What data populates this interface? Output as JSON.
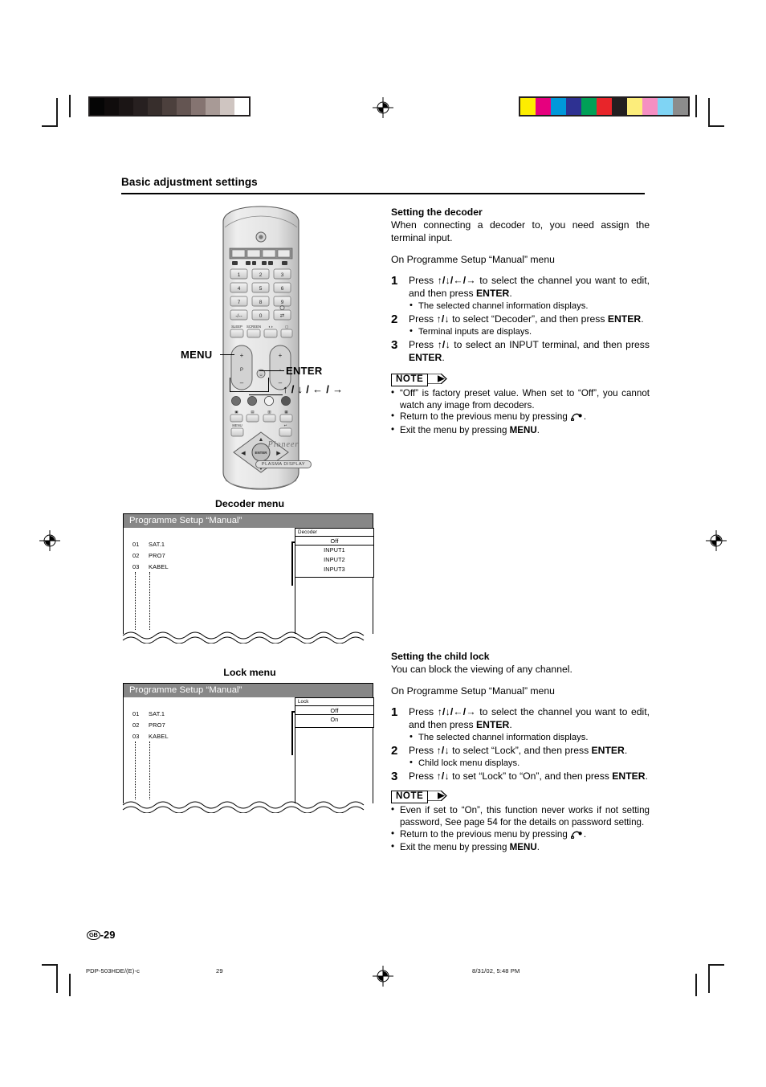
{
  "page": {
    "section_title": "Basic adjustment settings",
    "page_number": "-29",
    "page_locale_badge": "GB"
  },
  "footer": {
    "doc_id": "PDP-503HDE/(E)-c",
    "folio": "29",
    "timestamp": "8/31/02, 5:48 PM"
  },
  "remote": {
    "brand": "Pioneer",
    "model_badge": "PLASMA DISPLAY",
    "callouts": {
      "menu": "MENU",
      "enter": "ENTER",
      "dpad": "↑ / ↓ / ← / →"
    },
    "enter_button_label": "ENTER",
    "menu_button_label": "MENU"
  },
  "decoder_section": {
    "heading": "Setting the decoder",
    "intro": "When connecting a decoder to, you need assign the terminal input.",
    "context": "On Programme Setup “Manual” menu",
    "steps": [
      {
        "num": "1",
        "text_1": "Press ",
        "arrows": "↑/↓/←/→",
        "text_2": " to select the channel you want to edit, and then press ",
        "bold": "ENTER",
        "text_3": ".",
        "sub": "The selected channel information displays."
      },
      {
        "num": "2",
        "text_1": "Press ",
        "arrows": "↑/↓",
        "text_2": " to select “Decoder”, and then press ",
        "bold": "ENTER",
        "text_3": ".",
        "sub": "Terminal inputs are displays."
      },
      {
        "num": "3",
        "text_1": "Press ",
        "arrows": "↑/↓",
        "text_2": " to select an INPUT terminal, and then press ",
        "bold": "ENTER",
        "text_3": ".",
        "sub": ""
      }
    ],
    "note_label": "NOTE",
    "notes": [
      "“Off” is factory preset value. When set to “Off”, you cannot watch any image from decoders.",
      "Return to the previous menu by pressing",
      "Exit the menu by pressing"
    ],
    "note_3_bold": "MENU"
  },
  "lock_section": {
    "heading": "Setting the child lock",
    "intro": "You can block the viewing of any channel.",
    "context": "On Programme Setup “Manual” menu",
    "steps": [
      {
        "num": "1",
        "text_1": "Press ",
        "arrows": "↑/↓/←/→",
        "text_2": " to select the channel you want to edit, and then press ",
        "bold": "ENTER",
        "text_3": ".",
        "sub": "The selected channel information displays."
      },
      {
        "num": "2",
        "text_1": "Press ",
        "arrows": "↑/↓",
        "text_2": " to select “Lock”, and then press ",
        "bold": "ENTER",
        "text_3": ".",
        "sub": "Child lock menu displays."
      },
      {
        "num": "3",
        "text_1": "Press ",
        "arrows": "↑/↓",
        "text_2": " to set “Lock” to “On”, and then press ",
        "bold": "ENTER",
        "text_3": ".",
        "sub": ""
      }
    ],
    "note_label": "NOTE",
    "notes": [
      "Even if set to “On”, this function never works if not setting password, See page 54 for the details on password setting.",
      "Return to the previous menu by pressing",
      "Exit the menu by pressing"
    ],
    "note_3_bold": "MENU"
  },
  "decoder_menu_figure": {
    "caption": "Decoder menu",
    "osd_title": "Programme Setup “Manual”",
    "channels": [
      {
        "no": "01",
        "name": "SAT.1"
      },
      {
        "no": "02",
        "name": "PRO7"
      },
      {
        "no": "03",
        "name": "KABEL"
      }
    ],
    "submenu_label": "Decoder",
    "options": [
      "Off",
      "INPUT1",
      "INPUT2",
      "INPUT3"
    ],
    "selected_option": "Off"
  },
  "lock_menu_figure": {
    "caption": "Lock menu",
    "osd_title": "Programme Setup “Manual”",
    "channels": [
      {
        "no": "01",
        "name": "SAT.1"
      },
      {
        "no": "02",
        "name": "PRO7"
      },
      {
        "no": "03",
        "name": "KABEL"
      }
    ],
    "submenu_label": "Lock",
    "options": [
      "Off",
      "On"
    ],
    "selected_option": "Off"
  },
  "print_marks": {
    "gray_bar_colors": [
      "#050505",
      "#100c0c",
      "#1b1515",
      "#272020",
      "#372e2c",
      "#4c403d",
      "#645552",
      "#857471",
      "#a89a96",
      "#cfc5c1",
      "#ffffff"
    ],
    "color_bar_colors": [
      "#fded00",
      "#e6007e",
      "#0098da",
      "#2e3192",
      "#00a057",
      "#e8252a",
      "#231f20",
      "#fced7b",
      "#f58fc2",
      "#7fd4f4",
      "#8c8c8c"
    ],
    "osd_title_bg": "#878787"
  }
}
